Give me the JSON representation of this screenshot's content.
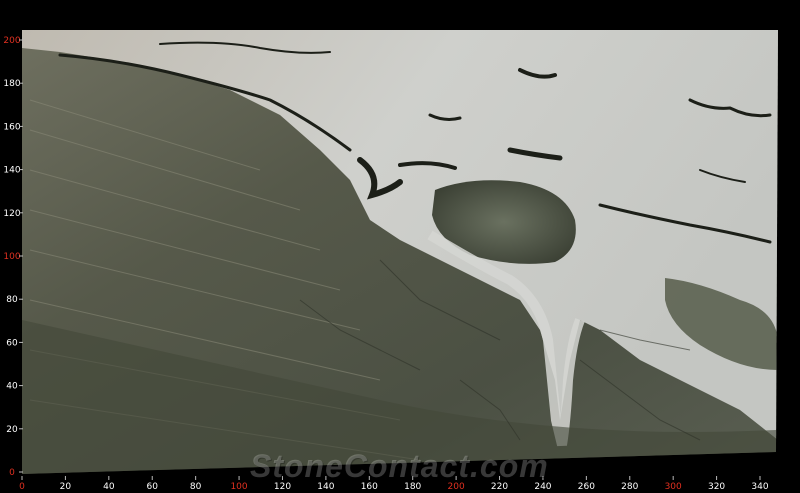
{
  "image": {
    "subject": "marble-slab",
    "watermark": "StoneContact.com"
  },
  "ruler": {
    "left_labels": [
      "200",
      "180",
      "160",
      "140",
      "120",
      "100",
      "80",
      "60",
      "40",
      "20",
      "0"
    ],
    "bottom_labels": [
      "0",
      "20",
      "40",
      "60",
      "80",
      "100",
      "120",
      "140",
      "160",
      "180",
      "200",
      "220",
      "240",
      "260",
      "280",
      "300",
      "320",
      "340"
    ],
    "highlight_labels": [
      "0",
      "100",
      "200",
      "300"
    ],
    "colors": {
      "normal": "#ffffff",
      "highlight": "#e03020",
      "tick": "#bbbbbb"
    }
  },
  "colors": {
    "background": "#000000",
    "slab_green": "#4a5040",
    "slab_light": "#c8cac6",
    "vein_dark": "#1c1f18"
  }
}
